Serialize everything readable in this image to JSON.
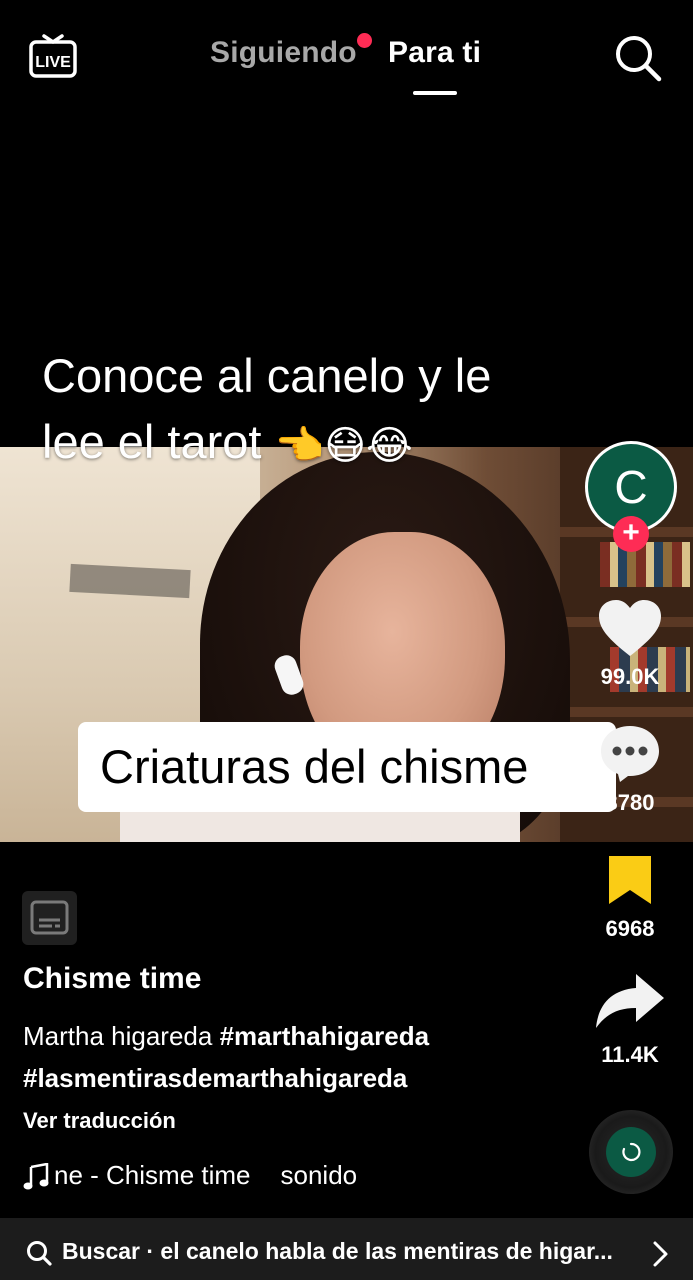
{
  "top_nav": {
    "live_icon": "live-tv-icon",
    "tabs": [
      {
        "label": "Siguiendo",
        "active": false,
        "has_notification": true
      },
      {
        "label": "Para ti",
        "active": true
      }
    ],
    "search_icon": "search-icon",
    "notification_color": "#fe2c55"
  },
  "video": {
    "caption_line1": "Conoce al canelo y le",
    "caption_line2": "lee el tarot",
    "caption_emojis": [
      "👈",
      "😷",
      "😂"
    ],
    "overlay_label": "Criaturas del chisme"
  },
  "rail": {
    "avatar_letter": "C",
    "avatar_color": "#0b5a44",
    "follow_icon": "plus-icon",
    "likes": "99.0K",
    "comments": "3780",
    "saves": "6968",
    "shares": "11.4K",
    "save_color": "#facc15"
  },
  "info": {
    "captions_icon": "captions-icon",
    "author": "Chisme time",
    "desc_text": "Martha higareda",
    "hashtag1": "#marthahigareda",
    "hashtag2": "#lasmentirasdemarthahigareda",
    "translate": "Ver traducción",
    "music_part1": "ne - Chisme time",
    "music_part2": "sonido"
  },
  "search_bar": {
    "text": "Buscar · el canelo habla de las mentiras de higar..."
  }
}
